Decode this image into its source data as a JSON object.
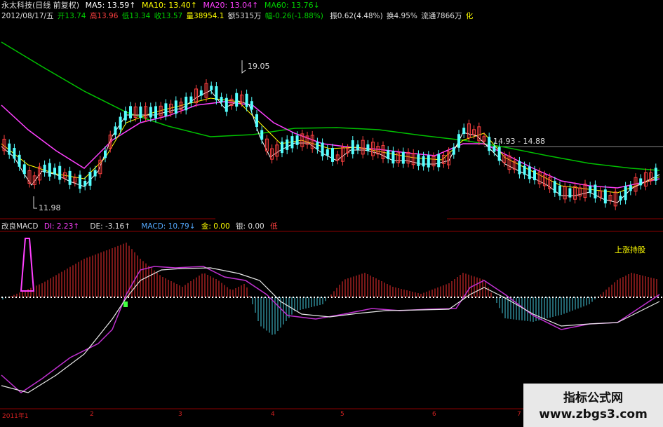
{
  "stock_header": {
    "name": "永太科技",
    "adjust": "(日线 前复权)",
    "ma5": "MA5: 13.59↑",
    "ma10": "MA10: 13.40↑",
    "ma20": "MA20: 13.04↑",
    "ma60": "MA60: 13.76↓"
  },
  "quote_line": {
    "date": "2012/08/17/五",
    "open": "开13.74",
    "high": "高13.96",
    "low": "低13.34",
    "close": "收13.57",
    "volume": "量38954.1",
    "amount": "额5315万",
    "change": "幅-0.26(-1.88%)",
    "amplitude": "振0.62(4.48%)",
    "turnover": "换4.95%",
    "float": "流通7866万",
    "tail": "化"
  },
  "price_annotations": {
    "high_marker": "19.05",
    "low_marker": "11.98",
    "range_label": "14.93 - 14.88"
  },
  "indicator_header": {
    "name": "改良MACD",
    "di": "DI: 2.23↑",
    "de": "DE: -3.16↑",
    "macd": "MACD: 10.79↓",
    "gold": "金: 0.00",
    "silver": "银: 0.00",
    "low": "低"
  },
  "indicator_label": "上涨持股",
  "time_axis": [
    "2011年1",
    "2",
    "3",
    "4",
    "5",
    "6",
    "7"
  ],
  "watermark": {
    "title": "指标公式网",
    "url": "www.zbgs3.com"
  },
  "colors": {
    "up": "#ff4040",
    "down": "#54ffff",
    "ma5": "#ffffff",
    "ma10": "#ffff00",
    "ma20": "#ff40ff",
    "ma60": "#00c000",
    "border": "#8b0000",
    "dotline": "#ffffff",
    "label_yellow": "#ffff00"
  }
}
